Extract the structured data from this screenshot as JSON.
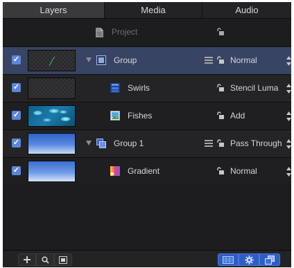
{
  "tabs": [
    {
      "label": "Layers",
      "active": true
    },
    {
      "label": "Media",
      "active": false
    },
    {
      "label": "Audio",
      "active": false
    }
  ],
  "project": {
    "label": "Project"
  },
  "layers": [
    {
      "name": "Group",
      "blend_mode": "Normal",
      "checked": true,
      "selected": true,
      "group": true,
      "expanded": true
    },
    {
      "name": "Swirls",
      "blend_mode": "Stencil Luma",
      "checked": true
    },
    {
      "name": "Fishes",
      "blend_mode": "Add",
      "checked": true
    },
    {
      "name": "Group 1",
      "blend_mode": "Pass Through",
      "checked": true,
      "group": true,
      "expanded": true
    },
    {
      "name": "Gradient",
      "blend_mode": "Normal",
      "checked": true
    }
  ],
  "colors": {
    "accent": "#5c87d8",
    "selected_row": "#384463",
    "panel_bg": "#1d1d1f"
  },
  "footer": {
    "left_icons": [
      "add-icon",
      "search-icon",
      "clip-icon"
    ],
    "right_icons": [
      "grid-icon",
      "gear-icon",
      "duplicate-icon"
    ]
  }
}
